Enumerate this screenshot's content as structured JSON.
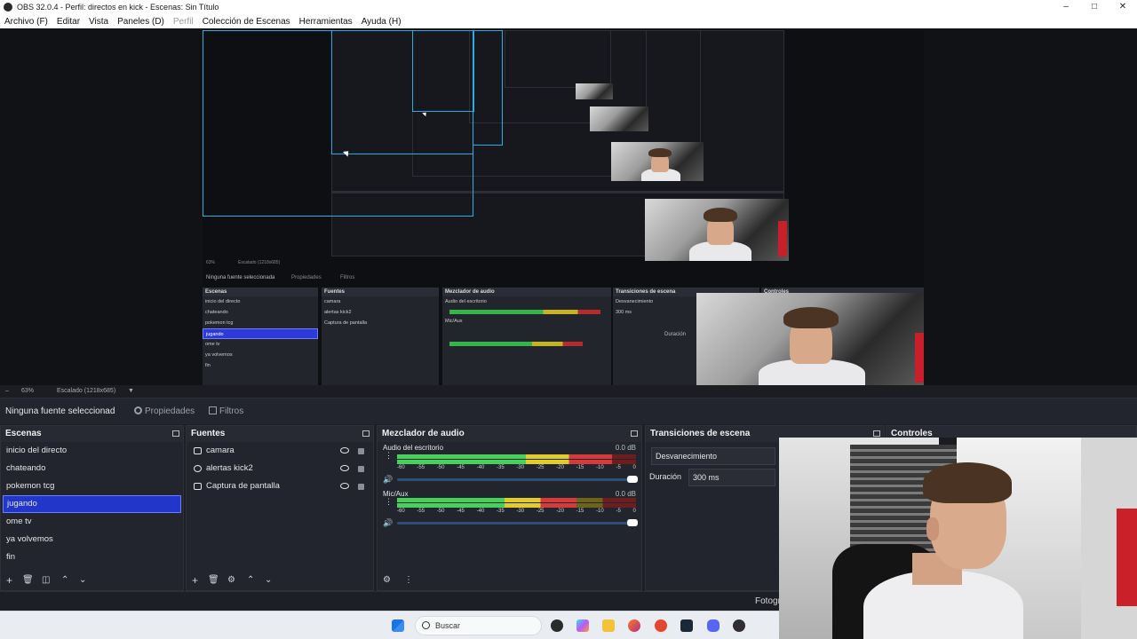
{
  "window": {
    "title": "OBS 32.0.4 - Perfil: directos en kick - Escenas: Sin Título",
    "minimize": "–",
    "maximize": "□",
    "close": "✕"
  },
  "menu": {
    "items": [
      "Archivo (F)",
      "Editar",
      "Vista",
      "Paneles (D)",
      "Perfil",
      "Colección de Escenas",
      "Herramientas",
      "Ayuda (H)"
    ]
  },
  "zoom": {
    "percent": "63%",
    "scaling": "Escalado (1218x685)"
  },
  "preview_nested": {
    "none_selected": "Ninguna fuente seleccionada",
    "properties": "Propiedades",
    "filters": "Filtros",
    "scenes_title": "Escenas",
    "sources_title": "Fuentes",
    "mixer_title": "Mezclador de audio",
    "transitions_title": "Transiciones de escena",
    "controls_title": "Controles",
    "desktop_audio": "Audio del escritorio",
    "mic_aux": "Mic/Aux",
    "fade": "Desvanecimiento",
    "duration_label": "Duración",
    "duration_value": "300 ms",
    "scenes": [
      "inicio del directo",
      "chateando",
      "pokemon tcg",
      "jugando",
      "ome tv",
      "ya volvemos",
      "fin"
    ],
    "sources": [
      "camara",
      "alertas kick2",
      "Captura de pantalla"
    ],
    "zoom_percent": "63%",
    "zoom_scaling": "Escalado (1218x685)"
  },
  "source_toolbar": {
    "no_source": "Ninguna fuente seleccionad",
    "properties": "Propiedades",
    "filters": "Filtros"
  },
  "scenes_dock": {
    "title": "Escenas",
    "items": [
      "inicio del directo",
      "chateando",
      "pokemon tcg",
      "jugando",
      "ome tv",
      "ya volvemos",
      "fin"
    ],
    "selected_index": 3
  },
  "sources_dock": {
    "title": "Fuentes",
    "items": [
      "camara",
      "alertas kick2",
      "Captura de pantalla"
    ]
  },
  "mixer_dock": {
    "title": "Mezclador de audio",
    "channels": [
      {
        "name": "Audio del escritorio",
        "db": "0.0 dB",
        "level": 0.9,
        "volume": 1.0
      },
      {
        "name": "Mic/Aux",
        "db": "0.0 dB",
        "level": 0.75,
        "volume": 1.0
      }
    ],
    "ticks": [
      "-60",
      "-55",
      "-50",
      "-45",
      "-40",
      "-35",
      "-30",
      "-25",
      "-20",
      "-15",
      "-10",
      "-5",
      "0"
    ]
  },
  "transitions_dock": {
    "title": "Transiciones de escena",
    "transition": "Desvanecimiento",
    "duration_label": "Duración",
    "duration_value": "300 ms"
  },
  "controls_dock": {
    "title": "Controles"
  },
  "status": {
    "fps_label": "Fotogr"
  },
  "taskbar": {
    "search_placeholder": "Buscar"
  },
  "colors": {
    "selection": "#2137c9",
    "accent_box": "#27aee0",
    "meter_green": "#47d05c",
    "meter_yellow": "#e0cd2a",
    "meter_red": "#d63b3b"
  }
}
